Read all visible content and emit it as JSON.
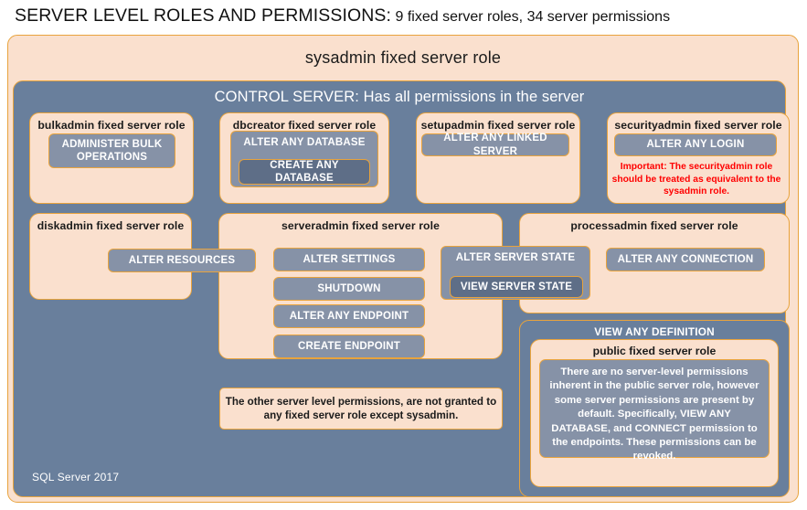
{
  "title": {
    "main": "SERVER LEVEL ROLES AND PERMISSIONS:",
    "sub": " 9 fixed server roles, 34 server permissions"
  },
  "diagram": {
    "sysadmin_label": "sysadmin  fixed  server  role",
    "control_server_label": "CONTROL SERVER: Has all permissions in the server",
    "footer": "SQL Server 2017",
    "colors": {
      "peach_fill": "#fae0ce",
      "slate_fill": "#697f9c",
      "pill_fill": "#8692a7",
      "pill_dark_fill": "#5e6e87",
      "border_gold": "#e8a33d",
      "warning_red": "#ff0000",
      "text_dark": "#1b1b1b",
      "text_light": "#ffffff"
    }
  },
  "roles": {
    "bulkadmin": {
      "label": "bulkadmin  fixed server role",
      "permissions": [
        "ADMINISTER  BULK OPERATIONS"
      ]
    },
    "dbcreator": {
      "label": "dbcreator fixed server role",
      "permissions": [
        "ALTER ANY DATABASE",
        "CREATE  ANY DATABASE"
      ]
    },
    "setupadmin": {
      "label": "setupadmin fixed server role",
      "permissions": [
        "ALTER ANY LINKED SERVER"
      ]
    },
    "securityadmin": {
      "label": "securityadmin  fixed server role",
      "permissions": [
        "ALTER ANY LOGIN"
      ],
      "note": "Important:  The securityadmin role should  be treated as equivalent to the  sysadmin role."
    },
    "diskadmin": {
      "label": "diskadmin  fixed server role",
      "permissions": [
        "ALTER RESOURCES"
      ]
    },
    "serveradmin": {
      "label": "serveradmin fixed server role",
      "permissions": [
        "ALTER SETTINGS",
        "SHUTDOWN",
        "ALTER ANY ENDPOINT",
        "CREATE  ENDPOINT"
      ]
    },
    "processadmin": {
      "label": "processadmin fixed server role",
      "permissions": [
        "ALTER ANY CONNECTION"
      ]
    },
    "shared": {
      "alter_server_state": "ALTER SERVER  STATE",
      "view_server_state": "VIEW SERVER  STATE"
    },
    "public": {
      "view_any_definition": "VIEW ANY DEFINITION",
      "label": "public  fixed server role",
      "note": "There are no server-level permissions inherent in the public  server role, however some server permissions  are present by default. Specifically,  VIEW ANY DATABASE, and CONNECT permission to the endpoints. These permissions can be revoked."
    }
  },
  "notes": {
    "other_permissions": "The other server level permissions,  are not granted to any fixed server role except sysadmin."
  }
}
